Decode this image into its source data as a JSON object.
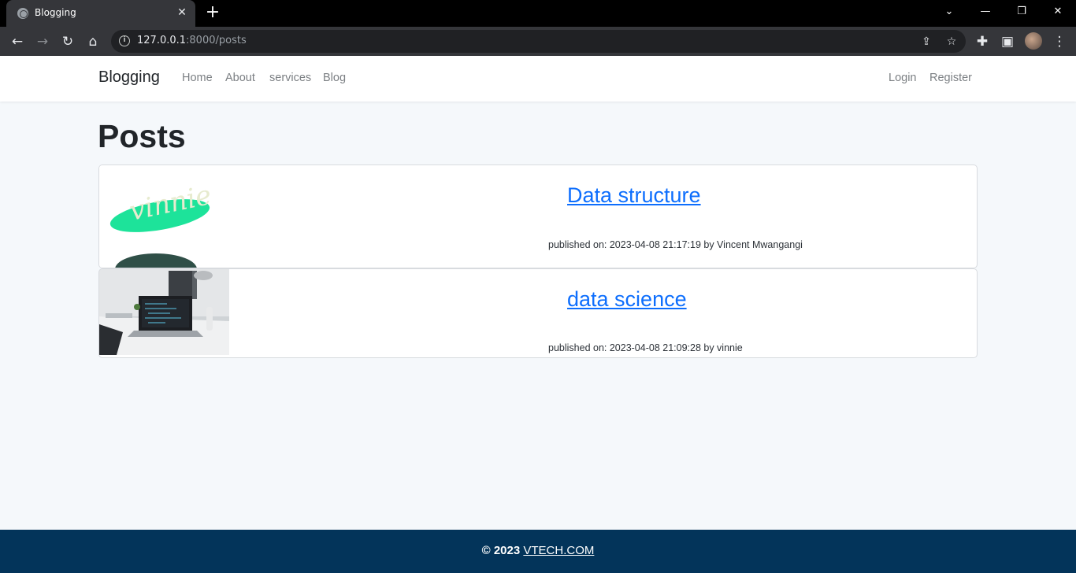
{
  "browser": {
    "tab_title": "Blogging",
    "url_host": "127.0.0.1",
    "url_rest": ":8000/posts"
  },
  "navbar": {
    "brand": "Blogging",
    "links": [
      "Home",
      "About",
      "services",
      "Blog"
    ],
    "auth": [
      "Login",
      "Register"
    ]
  },
  "main": {
    "title": "Posts",
    "posts": [
      {
        "title": "Data structure",
        "meta": "published on: 2023-04-08 21:17:19 by Vincent Mwangangi",
        "thumb_text": "vinnie"
      },
      {
        "title": "data science",
        "meta": "published on: 2023-04-08 21:09:28 by vinnie"
      }
    ]
  },
  "footer": {
    "copy": "© 2023",
    "link": "VTECH.COM"
  },
  "colors": {
    "link": "#0d6efd",
    "footer_bg": "#03345a",
    "page_bg": "#f5f8fb"
  }
}
